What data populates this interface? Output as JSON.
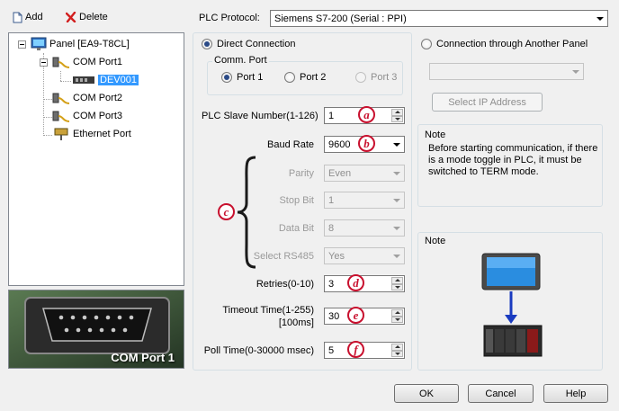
{
  "toolbar": {
    "add_label": "Add",
    "delete_label": "Delete"
  },
  "protocol": {
    "label": "PLC Protocol:",
    "value": "Siemens S7-200 (Serial : PPI)"
  },
  "tree": {
    "panel": "Panel [EA9-T8CL]",
    "com1": "COM Port1",
    "dev001": "DEV001",
    "com2": "COM Port2",
    "com3": "COM Port3",
    "ethernet": "Ethernet Port"
  },
  "preview": {
    "caption": "COM Port 1"
  },
  "connection": {
    "direct_label": "Direct Connection",
    "another_label": "Connection through Another Panel",
    "comm_port_label": "Comm. Port",
    "port1": "Port 1",
    "port2": "Port 2",
    "port3": "Port 3",
    "select_ip_label": "Select IP Address"
  },
  "fields": {
    "slave_label": "PLC Slave Number(1-126)",
    "slave_value": "1",
    "baud_label": "Baud Rate",
    "baud_value": "9600",
    "parity_label": "Parity",
    "parity_value": "Even",
    "stop_label": "Stop Bit",
    "stop_value": "1",
    "data_label": "Data Bit",
    "data_value": "8",
    "rs485_label": "Select RS485",
    "rs485_value": "Yes",
    "retries_label": "Retries(0-10)",
    "retries_value": "3",
    "timeout_label_1": "Timeout Time(1-255)",
    "timeout_label_2": "[100ms]",
    "timeout_value": "30",
    "poll_label": "Poll Time(0-30000 msec)",
    "poll_value": "5"
  },
  "callouts": {
    "a": "a",
    "b": "b",
    "c": "c",
    "d": "d",
    "e": "e",
    "f": "f"
  },
  "note1": {
    "title": "Note",
    "text": "Before starting communication, if there is a mode toggle in PLC, it must be switched to TERM mode."
  },
  "note2": {
    "title": "Note"
  },
  "buttons": {
    "ok": "OK",
    "cancel": "Cancel",
    "help": "Help"
  },
  "colors": {
    "callout": "#c8102e",
    "selection": "#3399ff"
  }
}
